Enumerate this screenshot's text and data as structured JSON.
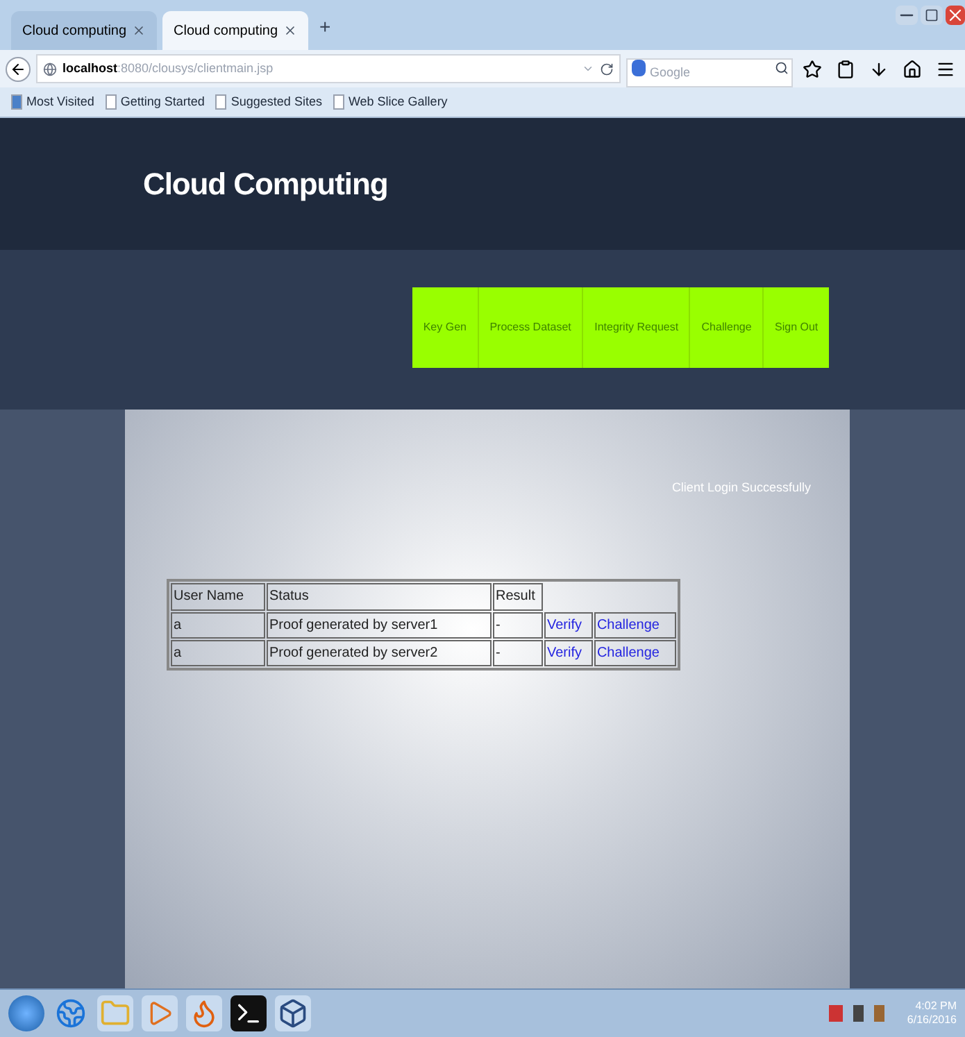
{
  "browser": {
    "tabs": [
      {
        "title": "Cloud computing",
        "selected": false
      },
      {
        "title": "Cloud computing",
        "selected": true
      }
    ],
    "new_tab": "+",
    "address": {
      "host": "localhost",
      "path": ":8080/clousys/clientmain.jsp"
    },
    "search": {
      "placeholder": "Google"
    },
    "bookmarks": [
      "Most Visited",
      "Getting Started",
      "Suggested Sites",
      "Web Slice Gallery"
    ]
  },
  "page": {
    "title": "Cloud Computing",
    "menu": [
      "Key Gen",
      "Process Dataset",
      "Integrity Request",
      "Challenge",
      "Sign Out"
    ],
    "message": "Client Login Successfully",
    "table": {
      "columns": [
        "User Name",
        "Status",
        "Result"
      ],
      "rows": [
        {
          "user": "a",
          "status": "Proof generated by server1",
          "result": "-",
          "actions": [
            "Verify",
            "Challenge"
          ]
        },
        {
          "user": "a",
          "status": "Proof generated by server2",
          "result": "-",
          "actions": [
            "Verify",
            "Challenge"
          ]
        }
      ]
    }
  },
  "taskbar": {
    "time": "4:02 PM",
    "date": "6/16/2016"
  }
}
